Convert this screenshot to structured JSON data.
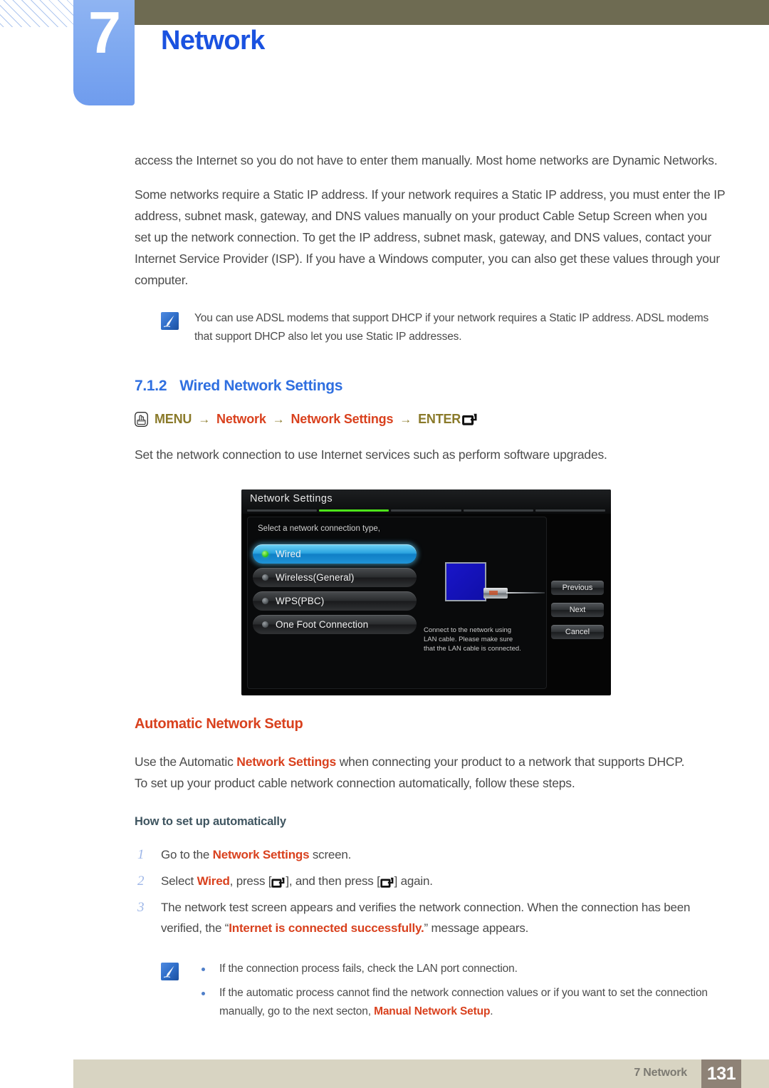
{
  "header": {
    "chapter_number": "7",
    "chapter_title": "Network"
  },
  "body": {
    "para1": "access the Internet so you do not have to enter them manually. Most home networks are Dynamic Networks.",
    "para2": "Some networks require a Static IP address. If your network requires a Static IP address, you must enter the IP address, subnet mask, gateway, and DNS values manually on your product Cable Setup Screen when you set up the network connection. To get the IP address, subnet mask, gateway, and DNS values, contact your Internet Service Provider (ISP). If you have a Windows computer, you can also get these values through your computer.",
    "note1": "You can use ADSL modems that support DHCP if your network requires a Static IP address. ADSL modems that support DHCP also let you use Static IP addresses.",
    "intro_line": "Set the network connection to use Internet services such as perform software upgrades."
  },
  "section": {
    "number": "7.1.2",
    "title": "Wired Network Settings"
  },
  "menu_path": {
    "hand_icon": "hand-press-icon",
    "item1": "MENU",
    "item2": "Network",
    "item3": "Network Settings",
    "item4": "ENTER",
    "arrow": "→",
    "enter_icon": "enter-key-icon"
  },
  "auto_setup": {
    "heading": "Automatic Network Setup",
    "para_a": "Use the Automatic ",
    "para_a_hl": "Network Settings",
    "para_a_rest": " when connecting your product to a network that supports DHCP.",
    "para_b": "To set up your product cable network connection automatically, follow these steps.",
    "subheading": "How to set up automatically",
    "steps": [
      {
        "num": "1",
        "pre": "Go to the ",
        "hl": "Network Settings",
        "post": " screen."
      },
      {
        "num": "2",
        "pre": "Select ",
        "hl": "Wired",
        "post": ", press [",
        "post2": "], and then press [",
        "post3": "] again."
      },
      {
        "num": "3",
        "pre": "The network test screen appears and verifies the network connection. When the connection has been verified, the “",
        "hl": "Internet is connected successfully.",
        "post": "” message appears."
      }
    ],
    "note2_bullet1": "If the connection process fails, check the LAN port connection.",
    "note2_bullet2_pre": "If the automatic process cannot find the network connection values or if you want to set the connection manually, go to the next secton, ",
    "note2_bullet2_hl": "Manual Network Setup",
    "note2_bullet2_post": "."
  },
  "tv_screen": {
    "title": "Network Settings",
    "prompt": "Select a network connection type,",
    "progress_total": 5,
    "progress_active_index": 1,
    "options": [
      {
        "label": "Wired",
        "selected": true
      },
      {
        "label": "Wireless(General)",
        "selected": false
      },
      {
        "label": "WPS(PBC)",
        "selected": false
      },
      {
        "label": "One Foot Connection",
        "selected": false
      }
    ],
    "description": "Connect to the network using LAN cable. Please make sure that the LAN cable is connected.",
    "buttons": [
      "Previous",
      "Next",
      "Cancel"
    ],
    "lan_port_icon": "lan-port-icon",
    "lan_plug_icon": "rj45-plug-icon"
  },
  "footer": {
    "label": "7 Network",
    "page_number": "131"
  },
  "colors": {
    "chapter_blue": "#1a52e0",
    "tab_blue": "#7ca7f0",
    "olive_bar": "#6e6b52",
    "accent_red": "#d9411e",
    "accent_olive": "#8a7a2a",
    "section_blue": "#2f6fe0",
    "subsub_slate": "#3f5560",
    "step_number_blue": "#9db6e8",
    "footer_bar": "#d8d4c2",
    "footer_page_box": "#8e8276",
    "tv_highlight_green": "#4ee31a",
    "tv_selected_blue": "#2aa4e0"
  }
}
